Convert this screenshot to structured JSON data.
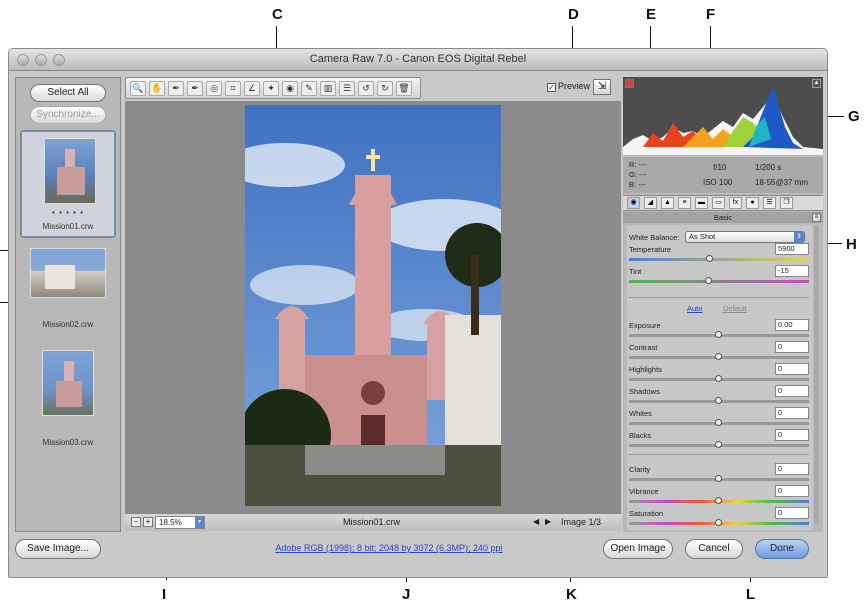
{
  "callouts": {
    "C": "C",
    "D": "D",
    "E": "E",
    "F": "F",
    "G": "G",
    "H": "H",
    "I": "I",
    "J": "J",
    "K": "K",
    "L": "L"
  },
  "window": {
    "title": "Camera Raw 7.0  -  Canon EOS Digital Rebel"
  },
  "filmstrip": {
    "select_all": "Select All",
    "synchronize": "Synchronize...",
    "items": [
      {
        "name": "Mission01.crw",
        "rating": "• • • • •"
      },
      {
        "name": "Mission02.crw"
      },
      {
        "name": "Mission03.crw"
      }
    ]
  },
  "toolbar": {
    "tools": [
      {
        "icon": "zoom-tool-icon",
        "glyph": "🔍"
      },
      {
        "icon": "hand-tool-icon",
        "glyph": "✋"
      },
      {
        "icon": "white-balance-tool-icon",
        "glyph": "✒"
      },
      {
        "icon": "color-sampler-tool-icon",
        "glyph": "✒"
      },
      {
        "icon": "targeted-adjustment-tool-icon",
        "glyph": "◎"
      },
      {
        "icon": "crop-tool-icon",
        "glyph": "⌗"
      },
      {
        "icon": "straighten-tool-icon",
        "glyph": "∠"
      },
      {
        "icon": "spot-removal-tool-icon",
        "glyph": "✦"
      },
      {
        "icon": "red-eye-removal-tool-icon",
        "glyph": "◉"
      },
      {
        "icon": "adjustment-brush-icon",
        "glyph": "✎"
      },
      {
        "icon": "graduated-filter-icon",
        "glyph": "▥"
      },
      {
        "icon": "preferences-icon",
        "glyph": "☰"
      },
      {
        "icon": "rotate-left-icon",
        "glyph": "↺"
      },
      {
        "icon": "rotate-right-icon",
        "glyph": "↻"
      },
      {
        "icon": "trash-icon",
        "glyph": "🗑"
      }
    ]
  },
  "preview": {
    "label": "Preview",
    "checked": "✓"
  },
  "statusbar": {
    "zoom": "18.5%",
    "filename": "Mission01.crw",
    "image_count": "Image 1/3"
  },
  "info": {
    "r": "R:  ---",
    "g": "G:  ---",
    "b": "B:  ---",
    "aperture": "f/10",
    "shutter": "1/200 s",
    "iso": "ISO 100",
    "lens": "18-55@37 mm"
  },
  "panel": {
    "title": "Basic",
    "white_balance_label": "White Balance:",
    "white_balance_value": "As Shot",
    "temperature": {
      "label": "Temperature",
      "value": "5900",
      "pos": 0.45
    },
    "tint": {
      "label": "Tint",
      "value": "-15",
      "pos": 0.44
    },
    "auto": "Auto",
    "default": "Default",
    "exposure": {
      "label": "Exposure",
      "value": "0.00",
      "pos": 0.5
    },
    "contrast": {
      "label": "Contrast",
      "value": "0",
      "pos": 0.5
    },
    "highlights": {
      "label": "Highlights",
      "value": "0",
      "pos": 0.5
    },
    "shadows": {
      "label": "Shadows",
      "value": "0",
      "pos": 0.5
    },
    "whites": {
      "label": "Whites",
      "value": "0",
      "pos": 0.5
    },
    "blacks": {
      "label": "Blacks",
      "value": "0",
      "pos": 0.5
    },
    "clarity": {
      "label": "Clarity",
      "value": "0",
      "pos": 0.5
    },
    "vibrance": {
      "label": "Vibrance",
      "value": "0",
      "pos": 0.5
    },
    "saturation": {
      "label": "Saturation",
      "value": "0",
      "pos": 0.5
    }
  },
  "footer": {
    "save": "Save Image...",
    "workflow": "Adobe RGB (1998); 8 bit; 2048 by 3072 (6.3MP); 240 ppi",
    "open": "Open Image",
    "cancel": "Cancel",
    "done": "Done"
  },
  "colors": {
    "accent": "#5b84c9",
    "link": "#2a44c4"
  }
}
